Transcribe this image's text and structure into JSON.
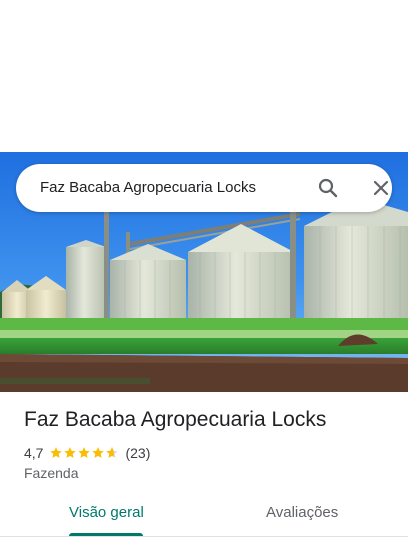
{
  "search": {
    "query": "Faz Bacaba Agropecuaria Locks"
  },
  "place": {
    "name": "Faz Bacaba Agropecuaria Locks",
    "rating": "4,7",
    "rating_stars": 4.7,
    "review_count": "(23)",
    "category": "Fazenda"
  },
  "tabs": [
    {
      "label": "Visão geral",
      "selected": true
    },
    {
      "label": "Avaliações",
      "selected": false
    }
  ],
  "colors": {
    "accent": "#00796b",
    "star": "#fbbc04"
  },
  "icons": {
    "search": "search-icon",
    "close": "close-icon",
    "star": "star-icon"
  }
}
